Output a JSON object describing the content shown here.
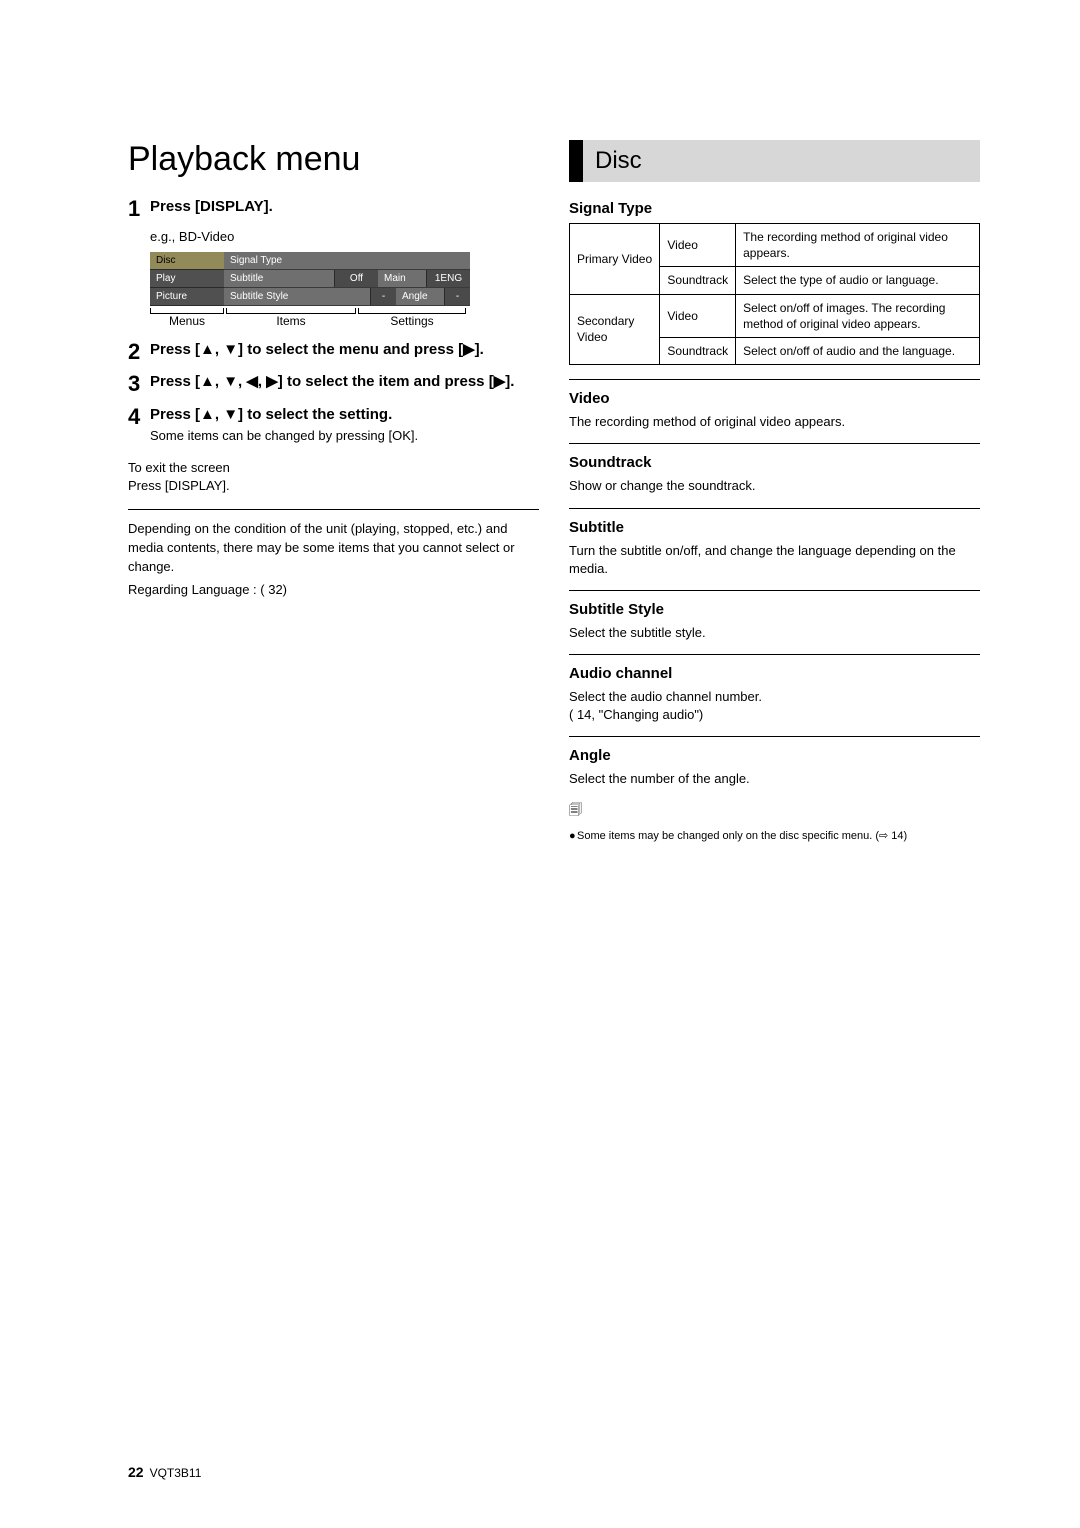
{
  "title": "Playback menu",
  "steps": [
    {
      "num": "1",
      "text": "Press [DISPLAY]."
    },
    {
      "num": "2",
      "text": "Press [▲, ▼] to select the menu and press [▶]."
    },
    {
      "num": "3",
      "text": "Press [▲, ▼, ◀, ▶] to select the item and press [▶]."
    },
    {
      "num": "4",
      "text": "Press [▲, ▼] to select the setting.",
      "extra": "Some items can be changed by pressing [OK]."
    }
  ],
  "eg": "e.g., BD-Video",
  "osd": {
    "menus": [
      "Disc",
      "Play",
      "Picture"
    ],
    "items": [
      {
        "name": "Signal Type"
      },
      {
        "name": "Subtitle",
        "val1": "Off",
        "label2": "Main",
        "val2": "1ENG"
      },
      {
        "name": "Subtitle Style",
        "val1": "-",
        "label2": "Angle",
        "val2": "-"
      }
    ],
    "labels": {
      "menus": "Menus",
      "items": "Items",
      "settings": "Settings"
    }
  },
  "exit": {
    "t": "To exit the screen",
    "b": "Press [DISPLAY]."
  },
  "notes": [
    "Depending on the condition of the unit (playing, stopped, etc.) and media contents, there may be some items that you cannot select or change.",
    "Regarding Language : (   32)"
  ],
  "section": "Disc",
  "signal_type_h": "Signal Type",
  "signal_table": {
    "r1c1": "Primary Video",
    "r1c2": "Video",
    "r1c3": "The recording method of original video appears.",
    "r2c2": "Soundtrack",
    "r2c3": "Select the type of audio or language.",
    "r3c1": "Secondary Video",
    "r3c2": "Video",
    "r3c3": "Select on/off of images. The recording method of original video appears.",
    "r4c2": "Soundtrack",
    "r4c3": "Select on/off of audio and the language."
  },
  "defs": [
    {
      "h": "Video",
      "d": "The recording method of original video appears."
    },
    {
      "h": "Soundtrack",
      "d": "Show or change the soundtrack."
    },
    {
      "h": "Subtitle",
      "d": "Turn the subtitle on/off, and change the language depending on the media."
    },
    {
      "h": "Subtitle Style",
      "d": "Select the subtitle style."
    },
    {
      "h": "Audio channel",
      "d": "Select the audio channel number.\n(   14, \"Changing audio\")"
    },
    {
      "h": "Angle",
      "d": "Select the number of the angle."
    }
  ],
  "footnote": "Some items may be changed only on the disc specific menu. (⇨ 14)",
  "page_number": "22",
  "doc_code": "VQT3B11"
}
